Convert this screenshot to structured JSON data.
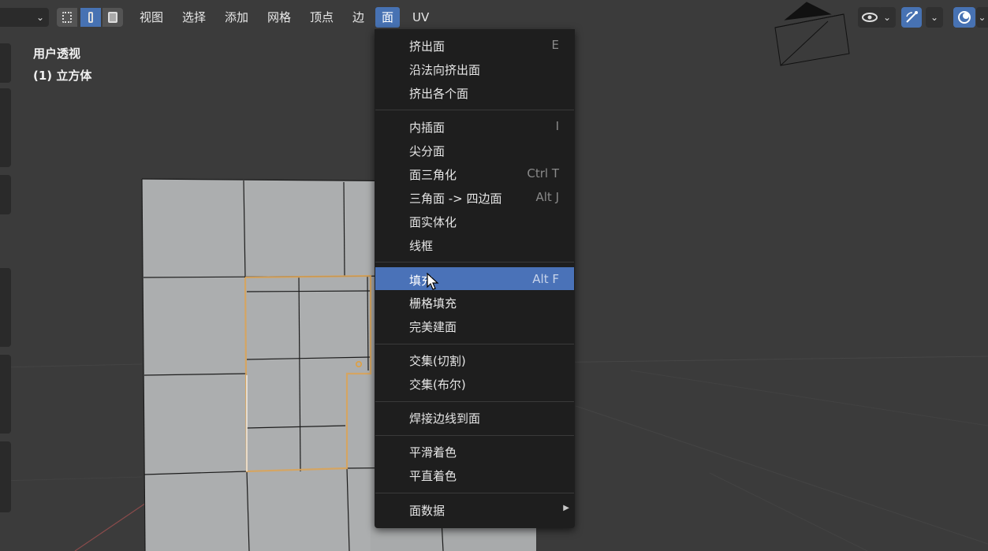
{
  "header": {
    "menus": [
      {
        "label": "视图"
      },
      {
        "label": "选择"
      },
      {
        "label": "添加"
      },
      {
        "label": "网格"
      },
      {
        "label": "顶点"
      },
      {
        "label": "边"
      },
      {
        "label": "面"
      },
      {
        "label": "UV"
      }
    ],
    "active_menu": "面",
    "select_modes": [
      "vertex-select",
      "edge-select",
      "face-select"
    ],
    "active_select_mode": "edge-select"
  },
  "viewport": {
    "view_name": "用户透视",
    "object_name": "(1) 立方体"
  },
  "face_menu": {
    "groups": [
      [
        {
          "label": "挤出面",
          "shortcut": "E"
        },
        {
          "label": "沿法向挤出面",
          "shortcut": ""
        },
        {
          "label": "挤出各个面",
          "shortcut": ""
        }
      ],
      [
        {
          "label": "内插面",
          "shortcut": "I"
        },
        {
          "label": "尖分面",
          "shortcut": ""
        },
        {
          "label": "面三角化",
          "shortcut": "Ctrl T"
        },
        {
          "label": "三角面 -> 四边面",
          "shortcut": "Alt J"
        },
        {
          "label": "面实体化",
          "shortcut": ""
        },
        {
          "label": "线框",
          "shortcut": ""
        }
      ],
      [
        {
          "label": "填充",
          "shortcut": "Alt F"
        },
        {
          "label": "栅格填充",
          "shortcut": ""
        },
        {
          "label": "完美建面",
          "shortcut": ""
        }
      ],
      [
        {
          "label": "交集(切割)",
          "shortcut": ""
        },
        {
          "label": "交集(布尔)",
          "shortcut": ""
        }
      ],
      [
        {
          "label": "焊接边线到面",
          "shortcut": ""
        }
      ],
      [
        {
          "label": "平滑着色",
          "shortcut": ""
        },
        {
          "label": "平直着色",
          "shortcut": ""
        }
      ],
      [
        {
          "label": "面数据",
          "shortcut": "",
          "submenu": true
        }
      ]
    ],
    "highlighted": "填充"
  },
  "overlay_icons": [
    "eye-icon",
    "gizmo-icon",
    "overlay-icon"
  ],
  "colors": {
    "accent": "#4772b3",
    "menu_bg": "#1e1e1e",
    "viewport_bg": "#3b3b3b",
    "selection": "#e0a040"
  }
}
